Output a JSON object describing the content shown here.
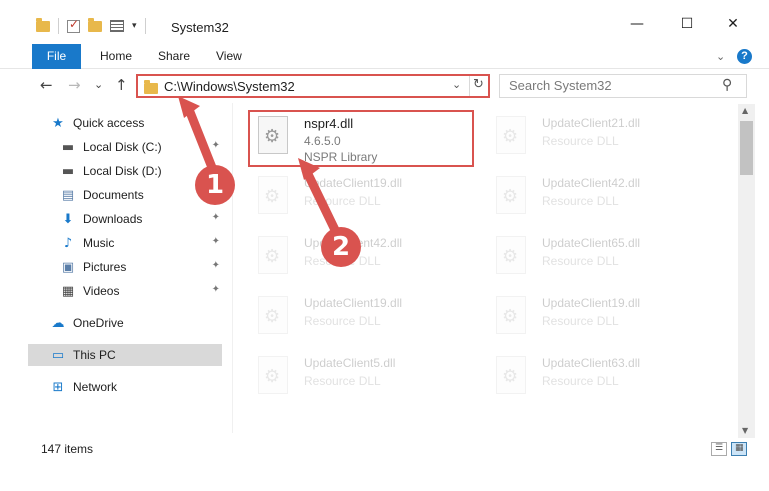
{
  "window": {
    "title": "System32",
    "minimize": "—",
    "maximize": "☐",
    "close": "✕"
  },
  "ribbon": {
    "tabs": [
      "File",
      "Home",
      "Share",
      "View"
    ]
  },
  "nav": {
    "back": "←",
    "forward": "→",
    "recent": "⌄",
    "up": "↑"
  },
  "address": {
    "path": "C:\\Windows\\System32",
    "dropdown": "⌄",
    "refresh": "↻"
  },
  "search": {
    "placeholder": "Search System32",
    "icon": "⚲"
  },
  "sidebar": {
    "items": [
      {
        "label": "Quick access",
        "icon": "star-icon",
        "glyph": "★",
        "pinned": false
      },
      {
        "label": "Local Disk (C:)",
        "icon": "drive-icon",
        "glyph": "▬",
        "pinned": true
      },
      {
        "label": "Local Disk (D:)",
        "icon": "drive-icon",
        "glyph": "▬",
        "pinned": false
      },
      {
        "label": "Documents",
        "icon": "documents-icon",
        "glyph": "▤",
        "pinned": true
      },
      {
        "label": "Downloads",
        "icon": "download-icon",
        "glyph": "⬇",
        "pinned": true
      },
      {
        "label": "Music",
        "icon": "music-icon",
        "glyph": "♪",
        "pinned": true
      },
      {
        "label": "Pictures",
        "icon": "pictures-icon",
        "glyph": "▣",
        "pinned": true
      },
      {
        "label": "Videos",
        "icon": "videos-icon",
        "glyph": "▦",
        "pinned": true
      },
      {
        "label": "OneDrive",
        "icon": "cloud-icon",
        "glyph": "☁",
        "pinned": false
      },
      {
        "label": "This PC",
        "icon": "computer-icon",
        "glyph": "▭",
        "pinned": false
      },
      {
        "label": "Network",
        "icon": "network-icon",
        "glyph": "⊞",
        "pinned": false
      }
    ],
    "pin_glyph": "📌"
  },
  "files": [
    {
      "name": "nspr4.dll",
      "line1": "4.6.5.0",
      "line2": "NSPR Library",
      "highlighted": true
    },
    {
      "name": "UpdateClient21.dll",
      "line1": "Resource DLL",
      "line2": "",
      "highlighted": false
    },
    {
      "name": "UpdateClient19.dll",
      "line1": "Resource DLL",
      "line2": "",
      "highlighted": false
    },
    {
      "name": "UpdateClient42.dll",
      "line1": "Resource DLL",
      "line2": "",
      "highlighted": false
    },
    {
      "name": "UpdateClient42.dll",
      "line1": "Resource DLL",
      "line2": "",
      "highlighted": false
    },
    {
      "name": "UpdateClient65.dll",
      "line1": "Resource DLL",
      "line2": "",
      "highlighted": false
    },
    {
      "name": "UpdateClient19.dll",
      "line1": "Resource DLL",
      "line2": "",
      "highlighted": false
    },
    {
      "name": "UpdateClient19.dll",
      "line1": "Resource DLL",
      "line2": "",
      "highlighted": false
    },
    {
      "name": "UpdateClient5.dll",
      "line1": "Resource DLL",
      "line2": "",
      "highlighted": false
    },
    {
      "name": "UpdateClient63.dll",
      "line1": "Resource DLL",
      "line2": "",
      "highlighted": false
    }
  ],
  "status": {
    "count": "147 items"
  },
  "annotations": {
    "step1": "1",
    "step2": "2"
  },
  "colors": {
    "accent": "#1979ca",
    "annotation": "#d9534f"
  }
}
